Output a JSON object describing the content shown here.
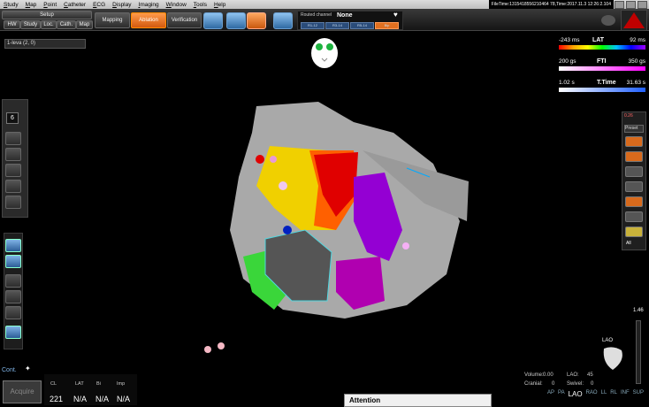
{
  "menu": [
    "Study",
    "Map",
    "Point",
    "Catheter",
    "ECG",
    "Display",
    "Imaging",
    "Window",
    "Tools",
    "Help"
  ],
  "file_info": "FileTime:1315418556210464 78,Time:2017.11.3 12:26:2.104",
  "toolbar": {
    "setup_label": "Setup",
    "sub_tabs": [
      "HW",
      "Study",
      "Loc.",
      "Cath.",
      "Map"
    ],
    "mapping_label": "Mapping",
    "ablation_label": "Ablation",
    "verification_label": "Verification"
  },
  "routed": {
    "label": "Routed channel",
    "value": "None",
    "segments": [
      "R1-12",
      "R3-14",
      "R5-14",
      "Bip"
    ]
  },
  "map_selector": "1-leva (2, 0)",
  "legends": {
    "lat": {
      "min": "-243 ms",
      "title": "LAT",
      "max": "92 ms"
    },
    "fti": {
      "min": "200 gs",
      "title": "FTI",
      "max": "350 gs"
    },
    "ttime": {
      "min": "1.02 s",
      "title": "T.Time",
      "max": "31.63 s"
    }
  },
  "right_panel": {
    "top_label": "0.26",
    "preset_label": "Preset",
    "all_label": "All"
  },
  "left_counter": "6",
  "cont_label": "Cont.",
  "acquire_label": "Acquire",
  "bottom": {
    "headers": [
      "CL",
      "LAT",
      "Bi",
      "Imp"
    ],
    "values": [
      "221",
      "N/A",
      "N/A",
      "N/A"
    ]
  },
  "attention_label": "Attention",
  "volume": {
    "label": "Volume:",
    "value": "0.00",
    "cranial_label": "Cranial:",
    "cranial_value": "0",
    "lao_label": "LAO:",
    "lao_value": "45",
    "swivel_label": "Swivel:",
    "swivel_value": "0"
  },
  "views": [
    "AP",
    "PA",
    "LAO",
    "RAO",
    "LL",
    "RL",
    "INF",
    "SUP"
  ],
  "zoom": "1.46",
  "orientation_label": "LAO",
  "lat_gradient": [
    "#ff0000",
    "#ffa500",
    "#ffff00",
    "#00ff00",
    "#00c0ff",
    "#0000ff",
    "#a000ff"
  ],
  "fti_gradient": [
    "#ffffff",
    "#ff00ff"
  ],
  "ttime_gradient": [
    "#ffffff",
    "#2060ff"
  ]
}
